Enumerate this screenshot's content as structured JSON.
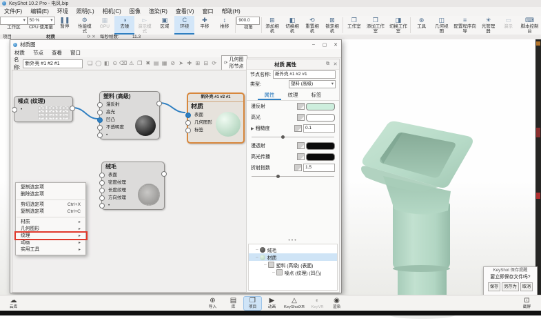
{
  "titlebar": {
    "app_title": "KeyShot 10.2 Pro - 电风.bip"
  },
  "menubar": {
    "items": [
      "文件(F)",
      "编辑(E)",
      "环境",
      "照明(L)",
      "相机(C)",
      "图像",
      "渲染(R)",
      "查看(V)",
      "窗口",
      "帮助(H)"
    ]
  },
  "toolbar": {
    "items": [
      {
        "label": "工作区",
        "glyph": "",
        "value": ""
      },
      {
        "label": "CPU 使用量",
        "glyph": "",
        "value": "50 %"
      },
      {
        "label": "暂停",
        "glyph": "❚❚"
      },
      {
        "label": "性能模式",
        "glyph": "⚙"
      },
      {
        "label": "GPU",
        "glyph": "▦"
      },
      {
        "label": "去噪",
        "glyph": "◑"
      },
      {
        "label": "演示模式",
        "glyph": "▻"
      },
      {
        "label": "区域",
        "glyph": "▣"
      },
      {
        "label": "环绕",
        "glyph": "C"
      },
      {
        "label": "平移",
        "glyph": "✚"
      },
      {
        "label": "推移",
        "glyph": "↕"
      },
      {
        "label": "视角",
        "glyph": "∠",
        "value": "900.0"
      },
      {
        "label": "添加相机",
        "glyph": "⊞"
      },
      {
        "label": "切换相机",
        "glyph": "◧"
      },
      {
        "label": "重置相机",
        "glyph": "⟲"
      },
      {
        "label": "锁定相机",
        "glyph": "⊠"
      },
      {
        "label": "工作室",
        "glyph": "❒"
      },
      {
        "label": "添加工作室",
        "glyph": "❒"
      },
      {
        "label": "切换工作室",
        "glyph": "◨"
      },
      {
        "label": "工具",
        "glyph": "⊛"
      },
      {
        "label": "几何视图",
        "glyph": "◫"
      },
      {
        "label": "配置程序向导",
        "glyph": "≡"
      },
      {
        "label": "光管理器",
        "glyph": "☀"
      },
      {
        "label": "演示",
        "glyph": "▭"
      },
      {
        "label": "脚本控制台",
        "glyph": "⌨"
      }
    ]
  },
  "tabrow": {
    "project_tab": "项目",
    "material_tab": "材质",
    "icons": "⟳ ✕",
    "fps_label": "每秒帧数:",
    "fps_value": "11.3"
  },
  "material_graph": {
    "window_title": "材质图",
    "window_buttons": [
      "–",
      "▢",
      "✕"
    ],
    "menus": [
      "材质",
      "节点",
      "查看",
      "窗口"
    ],
    "name_label": "名称:",
    "name_value": "新外壳 #1 #2 #1",
    "toolbar_icons": [
      "❏",
      "◯",
      "◧",
      "⊙",
      "⌫",
      "⚠",
      "❐",
      "✖",
      "▤",
      "▦",
      "⊘",
      "➤",
      "✚",
      "⊞",
      "⊟",
      "⟳"
    ],
    "geometry_toggle_icon": "⟳",
    "geometry_toggle": "几何图形节点",
    "nodes": {
      "noise": {
        "title": "噪点 (纹理)",
        "ports": [
          "•"
        ]
      },
      "plastic": {
        "title": "塑料 (高级)",
        "ports": [
          "漫反射",
          "高光",
          "凹凸",
          "不透明度",
          "•"
        ]
      },
      "material": {
        "name": "新外壳 #1 #2 #1",
        "title": "材质",
        "ports": [
          "表面",
          "几何图形",
          "标签"
        ]
      },
      "fuzz": {
        "title": "绒毛",
        "ports": [
          "表面",
          "密度纹理",
          "长度纹理",
          "方向纹理",
          "•"
        ]
      }
    },
    "context_menu": {
      "items": [
        "复制选定项",
        "删除选定项",
        "剪切选定项",
        "复制选定项",
        "材质",
        "几何图形",
        "纹理",
        "动画",
        "实用工具"
      ],
      "shortcut_cut": "Ctrl+X",
      "shortcut_copy": "Ctrl+C",
      "submenu_arrow": "▸"
    }
  },
  "properties": {
    "title": "材质 属性",
    "header_icons": [
      "⧉",
      "✕"
    ],
    "node_name_label": "节点名称:",
    "node_name_value": "新外壳 #1 #2 #1",
    "type_label": "类型:",
    "type_value": "塑料 (高级)",
    "tabs": [
      "属性",
      "纹理",
      "标签"
    ],
    "fields": [
      {
        "label": "漫反射"
      },
      {
        "label": "高光"
      },
      {
        "label": "粗糙度",
        "value": "0.1"
      },
      {
        "label": "漫透射"
      },
      {
        "label": "高光传播"
      },
      {
        "label": "折射指数",
        "value": "1.5"
      }
    ],
    "tree": [
      "绒毛",
      "材质",
      "塑料 (高级) (表面)",
      "噪点 (纹理) (凹凸)"
    ]
  },
  "bottom_toolbar": {
    "items": [
      {
        "label": "云库",
        "glyph": "☁"
      },
      {
        "label": "导入",
        "glyph": "⊕"
      },
      {
        "label": "库",
        "glyph": "▤"
      },
      {
        "label": "项目",
        "glyph": "❒"
      },
      {
        "label": "动画",
        "glyph": "▶"
      },
      {
        "label": "KeyShotXR",
        "glyph": "△"
      },
      {
        "label": "KeyVR",
        "glyph": "◐"
      },
      {
        "label": "渲染",
        "glyph": "◉"
      },
      {
        "label": "截屏",
        "glyph": "⊡"
      }
    ]
  },
  "save_dialog": {
    "title": "KeyShot 保存提醒",
    "message": "要立即保存文件吗?",
    "buttons": [
      "保存",
      "另存为",
      "取消"
    ]
  },
  "colors": {
    "accent_blue": "#2f7fc1",
    "selection_orange": "#d8873c",
    "wire_blue": "#2f7fc1",
    "annotation_red": "#e0382b",
    "model_mint": "#b7d9c6",
    "diffuse_swatch": "#cdeedd",
    "specular_swatch": "#ffffff",
    "transmission_swatch": "#0b0b0b",
    "specular_spread_swatch": "#0b0b0b"
  }
}
